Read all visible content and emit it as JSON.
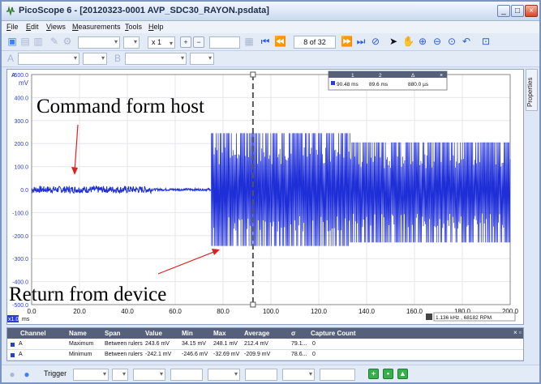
{
  "window": {
    "title": "PicoScope 6 - [20120323-0001 AVP_SDC30_RAYON.psdata]",
    "controls": [
      "_",
      "□",
      "×"
    ]
  },
  "menu": [
    "File",
    "Edit",
    "Views",
    "Measurements",
    "Tools",
    "Help"
  ],
  "toolbar": {
    "timebase_multiplier": "x 1",
    "zoom_in": "+",
    "zoom_out": "−",
    "page_counter": "8 of 32"
  },
  "properties_tab": "Properties",
  "plot": {
    "y_unit": "mV",
    "y_ticks": [
      "500.0",
      "400.0",
      "300.0",
      "200.0",
      "100.0",
      "0.0",
      "-100.0",
      "-200.0",
      "-300.0",
      "-400.0",
      "-500.0"
    ],
    "x_ticks": [
      "0.0",
      "20.0",
      "40.0",
      "60.0",
      "80.0",
      "100.0",
      "120.0",
      "140.0",
      "160.0",
      "180.0",
      "200.0"
    ],
    "x_scale_label": "x1.0",
    "x_unit": "ms",
    "frequency_readout": "1.136 kHz , 68182 RPM",
    "channel_marker": "A",
    "annotation_top": "Command form host",
    "annotation_bottom": "Return from device",
    "ruler_box": {
      "headers": [
        "1",
        "2",
        "Δ"
      ],
      "values": [
        "90.48 ms",
        "89.6 ms",
        "880.0 µs"
      ]
    }
  },
  "chart_data": {
    "type": "line",
    "series": [
      {
        "name": "A",
        "segments": [
          {
            "x": [
              0,
              50
            ],
            "y": [
              -15,
              15
            ],
            "note": "low-amplitude burst"
          },
          {
            "x": [
              50,
              75
            ],
            "y": [
              -5,
              5
            ]
          },
          {
            "x": [
              75,
              133
            ],
            "y": [
              -245,
              245
            ]
          },
          {
            "x": [
              133,
              200
            ],
            "y": [
              -230,
              205
            ]
          }
        ]
      }
    ],
    "xlim": [
      0,
      200
    ],
    "ylim": [
      -500,
      500
    ],
    "ruler_x": 92.5,
    "color": "#1f2fd8"
  },
  "measurements": {
    "headers": [
      "Channel",
      "Name",
      "Span",
      "Value",
      "Min",
      "Max",
      "Average",
      "σ",
      "Capture Count"
    ],
    "rows": [
      [
        "A",
        "Maximum",
        "Between rulers",
        "243.6 mV",
        "34.15 mV",
        "248.1 mV",
        "212.4 mV",
        "79.1...",
        "0"
      ],
      [
        "A",
        "Minimum",
        "Between rulers",
        "-242.1 mV",
        "-246.6 mV",
        "-32.69 mV",
        "-209.9 mV",
        "78.6...",
        "0"
      ]
    ]
  },
  "trigger": {
    "label": "Trigger"
  }
}
